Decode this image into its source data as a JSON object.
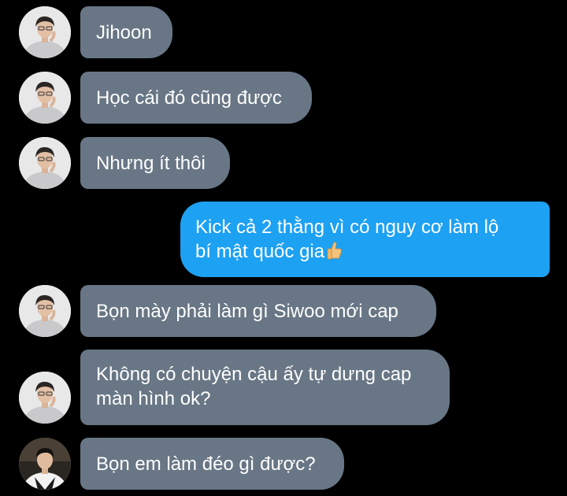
{
  "conversation": {
    "messages": [
      {
        "direction": "incoming",
        "avatar": "avatar-1",
        "text": "Jihoon"
      },
      {
        "direction": "incoming",
        "avatar": "avatar-1",
        "text": "Học cái đó cũng được"
      },
      {
        "direction": "incoming",
        "avatar": "avatar-1",
        "text": "Nhưng ít thôi"
      },
      {
        "direction": "outgoing",
        "line1": "Kick cả 2 thằng vì có nguy cơ làm lộ",
        "line2": "bí mật quốc gia",
        "emoji": "thumbs-up-emoji"
      },
      {
        "direction": "incoming",
        "avatar": "avatar-1",
        "text": "Bọn mày phải làm gì Siwoo mới cap"
      },
      {
        "direction": "incoming",
        "avatar": "avatar-1",
        "line1": "Không có chuyện cậu ấy tự dưng cap",
        "line2": "màn hình ok?"
      },
      {
        "direction": "incoming",
        "avatar": "avatar-2",
        "text": "Bọn em làm đéo gì được?"
      }
    ]
  },
  "colors": {
    "background": "#000000",
    "incoming_bubble": "#687685",
    "outgoing_bubble": "#1da1f2",
    "text": "#ffffff"
  }
}
